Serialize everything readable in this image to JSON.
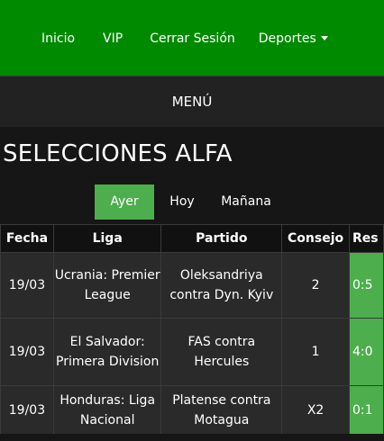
{
  "nav": {
    "items": [
      "Inicio",
      "VIP",
      "Cerrar Sesión",
      "Deportes"
    ]
  },
  "menu_label": "MENÚ",
  "page_title": "SELECCIONES ALFA",
  "tabs": [
    {
      "label": "Ayer",
      "active": true
    },
    {
      "label": "Hoy",
      "active": false
    },
    {
      "label": "Mañana",
      "active": false
    }
  ],
  "table": {
    "headers": [
      "Fecha",
      "Liga",
      "Partido",
      "Consejo",
      "Res"
    ],
    "rows": [
      {
        "fecha": "19/03",
        "liga": "Ucrania: Premier League",
        "partido": "Oleksandriya contra Dyn. Kyiv",
        "consejo": "2",
        "res": "0:5"
      },
      {
        "fecha": "19/03",
        "liga": "El Salvador: Primera Division",
        "partido": "FAS contra Hercules",
        "consejo": "1",
        "res": "4:0"
      },
      {
        "fecha": "19/03",
        "liga": "Honduras: Liga Nacional",
        "partido": "Platense contra Motagua",
        "consejo": "X2",
        "res": "0:1"
      }
    ]
  },
  "colors": {
    "nav_bg": "#008a00",
    "accent_green": "#4cae4c",
    "page_bg": "#161616"
  },
  "icons": {
    "deportes_dropdown": "caret-down-icon"
  }
}
